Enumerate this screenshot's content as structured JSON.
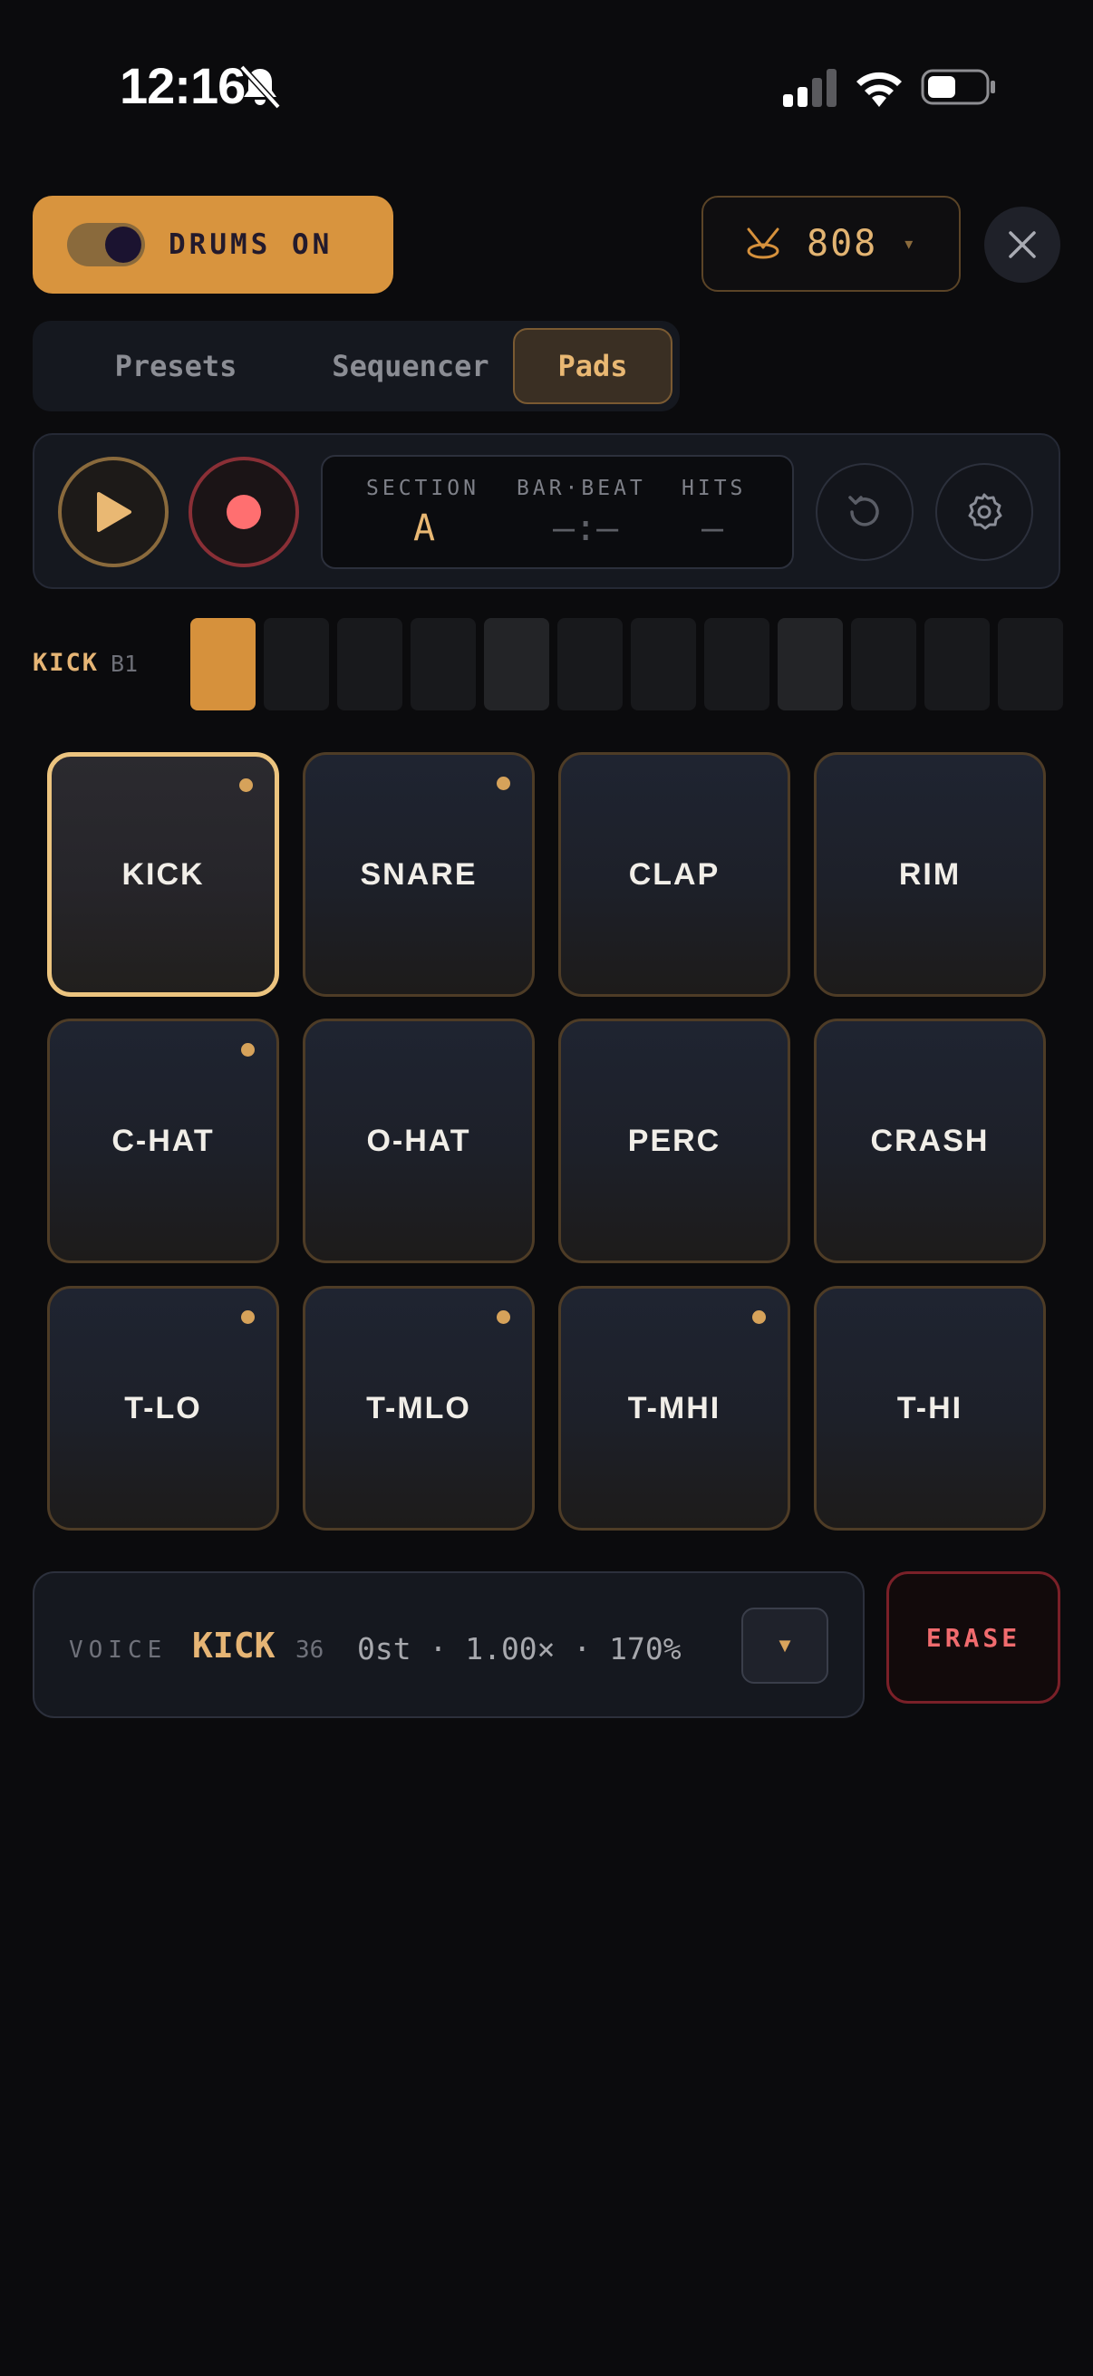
{
  "status_bar": {
    "time": "12:16"
  },
  "header": {
    "drums_toggle_label": "DRUMS ON",
    "kit_value": "808",
    "kit_caret": "▾"
  },
  "tabs": [
    {
      "label": "Presets",
      "active": false
    },
    {
      "label": "Sequencer",
      "active": false
    },
    {
      "label": "Pads",
      "active": true
    }
  ],
  "transport": {
    "section_label": "SECTION",
    "section_value": "A",
    "barbeat_label": "BAR·BEAT",
    "barbeat_value": "–:–",
    "hits_label": "HITS",
    "hits_value": "–"
  },
  "track": {
    "name": "KICK",
    "sub": "B1",
    "steps": [
      true,
      false,
      false,
      false,
      false,
      false,
      false,
      false,
      false,
      false,
      false,
      false
    ]
  },
  "pads": [
    {
      "label": "KICK",
      "dot": true,
      "selected": true
    },
    {
      "label": "SNARE",
      "dot": true,
      "selected": false
    },
    {
      "label": "CLAP",
      "dot": false,
      "selected": false
    },
    {
      "label": "RIM",
      "dot": false,
      "selected": false
    },
    {
      "label": "C-HAT",
      "dot": true,
      "selected": false
    },
    {
      "label": "O-HAT",
      "dot": false,
      "selected": false
    },
    {
      "label": "PERC",
      "dot": false,
      "selected": false
    },
    {
      "label": "CRASH",
      "dot": false,
      "selected": false
    },
    {
      "label": "T-LO",
      "dot": true,
      "selected": false
    },
    {
      "label": "T-MLO",
      "dot": true,
      "selected": false
    },
    {
      "label": "T-MHI",
      "dot": true,
      "selected": false
    },
    {
      "label": "T-HI",
      "dot": false,
      "selected": false
    }
  ],
  "voice": {
    "label": "VOICE",
    "name": "KICK",
    "note": "36",
    "params": "0st · 1.00× · 170%",
    "dropdown": "▼"
  },
  "erase_label": "ERASE",
  "colors": {
    "accent": "#d8943e",
    "accent_text": "#e6b575",
    "record": "#ff6f70",
    "erase": "#f06b6e",
    "background": "#0b0b0d"
  },
  "icons": [
    "bell-slash-icon",
    "signal-icon",
    "wifi-icon",
    "battery-icon",
    "drum-icon",
    "close-icon",
    "play-icon",
    "record-icon",
    "reset-icon",
    "gear-icon"
  ]
}
